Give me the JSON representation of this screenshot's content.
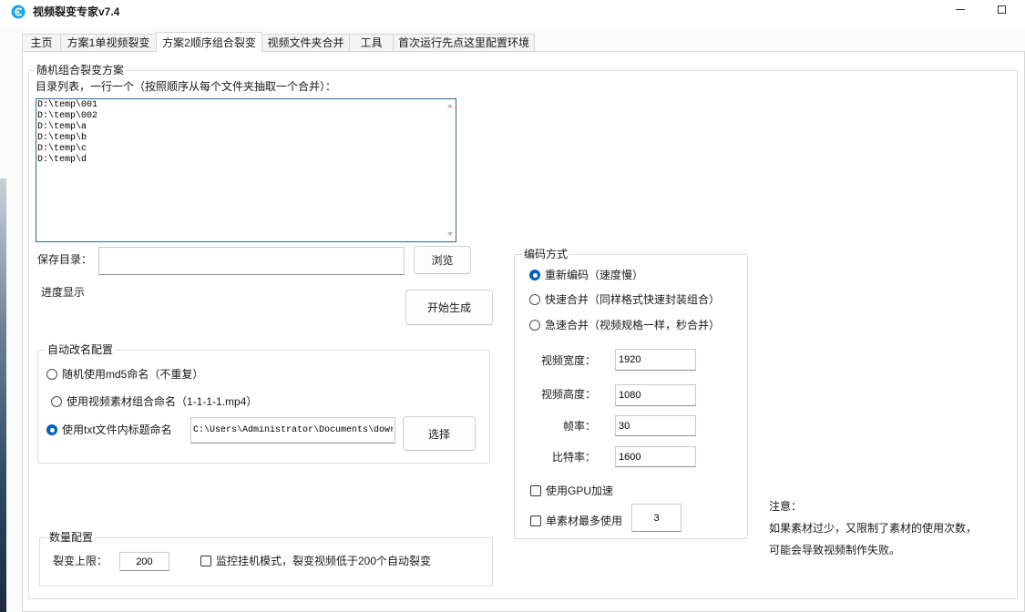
{
  "window": {
    "title": "视频裂变专家v7.4"
  },
  "tabs": [
    {
      "label": "主页",
      "selected": false
    },
    {
      "label": "方案1单视频裂变",
      "selected": false
    },
    {
      "label": "方案2顺序组合裂变",
      "selected": true
    },
    {
      "label": "视频文件夹合并",
      "selected": false
    },
    {
      "label": "工具",
      "selected": false
    },
    {
      "label": "首次运行先点这里配置环境",
      "selected": false
    }
  ],
  "combo": {
    "group_title": "随机组合裂变方案",
    "dir_list_label": "目录列表，一行一个（按照顺序从每个文件夹抽取一个合并）：",
    "dir_list_value": "D:\\temp\\001\nD:\\temp\\002\nD:\\temp\\a\nD:\\temp\\b\nD:\\temp\\c\nD:\\temp\\d",
    "save_dir_label": "保存目录：",
    "browse_button": "浏览",
    "progress_label": "进度显示",
    "start_button": "开始生成"
  },
  "rename": {
    "group_title": "自动改名配置",
    "options": [
      {
        "label": "随机使用md5命名（不重复）",
        "checked": false
      },
      {
        "label": "使用视频素材组合命名（1-1-1-1.mp4）",
        "checked": false
      },
      {
        "label": "使用txt文件内标题命名",
        "checked": true
      }
    ],
    "txt_path": "C:\\Users\\Administrator\\Documents\\dowr",
    "choose_button": "选择"
  },
  "quantity": {
    "group_title": "数量配置",
    "limit_label": "裂变上限：",
    "limit_value": "200",
    "monitor_label": "监控挂机模式，裂变视频低于200个自动裂变",
    "monitor_checked": false
  },
  "encoding": {
    "group_title": "编码方式",
    "options": [
      {
        "label": "重新编码（速度慢）",
        "checked": true
      },
      {
        "label": "快速合并（同样格式快速封装组合）",
        "checked": false
      },
      {
        "label": "急速合并（视频规格一样，秒合并）",
        "checked": false
      }
    ],
    "width_label": "视频宽度：",
    "width_value": "1920",
    "height_label": "视频高度：",
    "height_value": "1080",
    "fps_label": "帧率：",
    "fps_value": "30",
    "bitrate_label": "比特率：",
    "bitrate_value": "1600",
    "gpu_label": "使用GPU加速",
    "gpu_checked": false,
    "max_use_label": "单素材最多使用",
    "max_use_checked": false,
    "max_use_value": "3"
  },
  "notice": {
    "title": "注意：",
    "line1": "如果素材过少，又限制了素材的使用次数，",
    "line2": "可能会导致视频制作失败。"
  },
  "colors": {
    "accent": "#005fb8",
    "logo": "#1ea4ee"
  }
}
